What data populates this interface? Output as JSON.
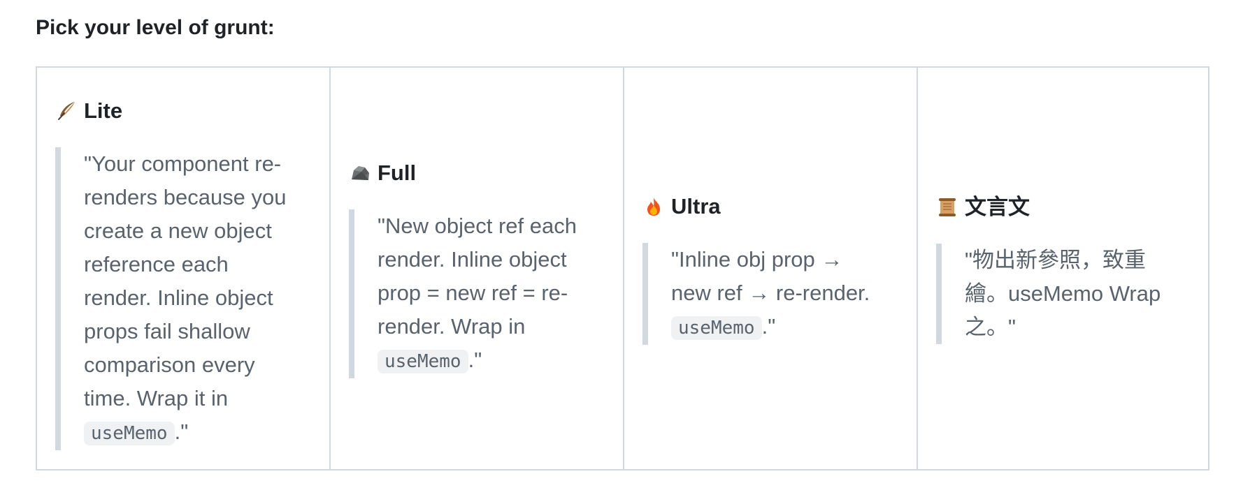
{
  "heading": "Pick your level of grunt:",
  "levels": [
    {
      "icon": "feather-icon",
      "title": "Lite",
      "quote_pre": "\"Your component re-renders because you create a new object reference each render. Inline object props fail shallow comparison every time. Wrap it in ",
      "code": "useMemo",
      "quote_post": ".\""
    },
    {
      "icon": "rock-icon",
      "title": "Full",
      "quote_pre": "\"New object ref each render. Inline object prop = new ref = re-render. Wrap in ",
      "code": "useMemo",
      "quote_post": ".\""
    },
    {
      "icon": "fire-icon",
      "title": "Ultra",
      "quote_pre": "\"Inline obj prop → new ref → re-render. ",
      "code": "useMemo",
      "quote_post": ".\""
    },
    {
      "icon": "scroll-icon",
      "title": "文言文",
      "quote_pre": "\"物出新參照，致重繪。useMemo Wrap之。\"",
      "code": "",
      "quote_post": ""
    }
  ]
}
